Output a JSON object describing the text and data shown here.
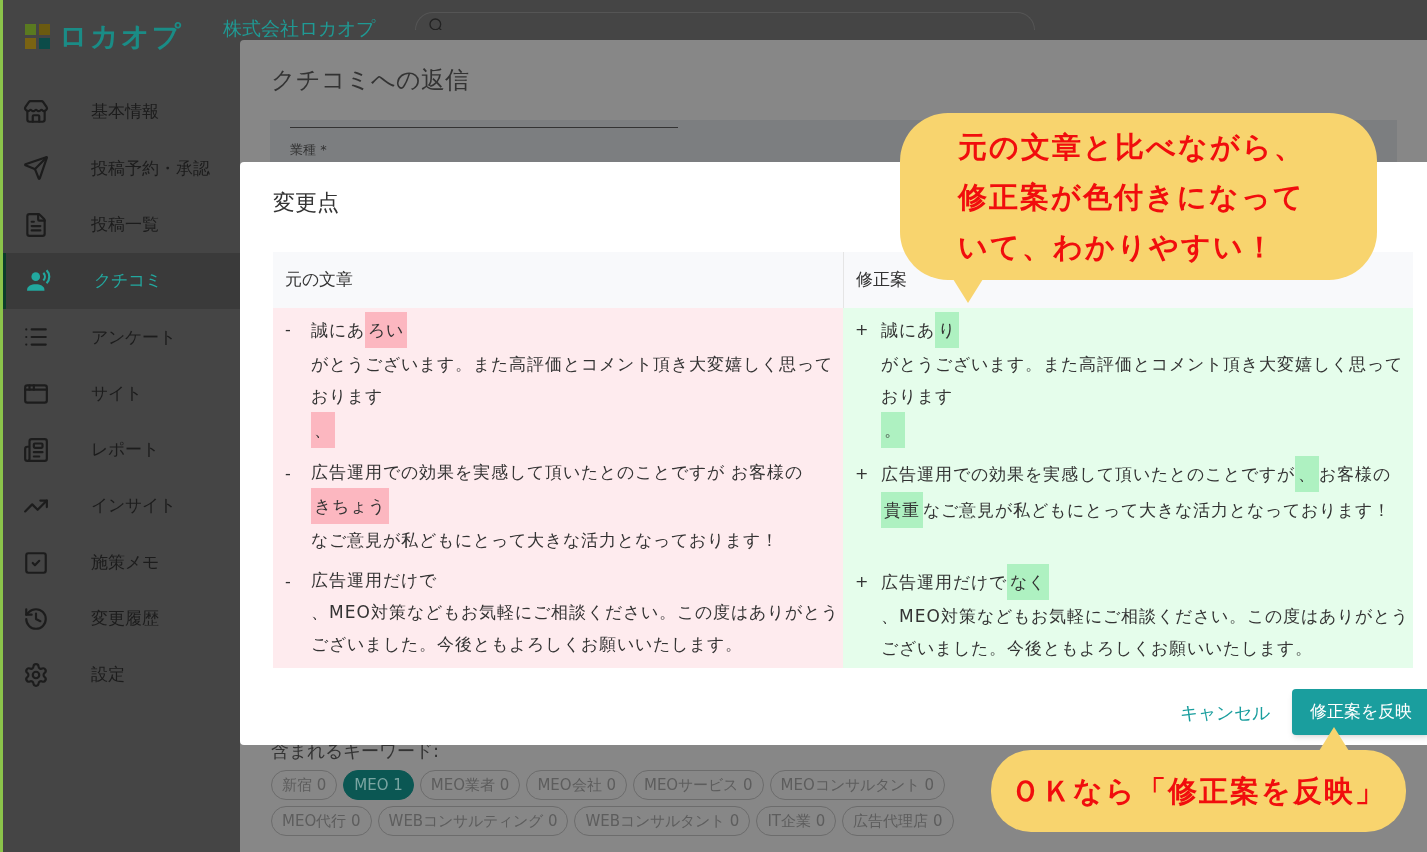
{
  "header": {
    "logo": "ロカオプ",
    "company": "株式会社ロカオプ"
  },
  "sidebar": {
    "items": [
      {
        "label": "基本情報",
        "selected": false
      },
      {
        "label": "投稿予約・承認",
        "selected": false
      },
      {
        "label": "投稿一覧",
        "selected": false
      },
      {
        "label": "クチコミ",
        "selected": true
      },
      {
        "label": "アンケート",
        "selected": false
      },
      {
        "label": "サイト",
        "selected": false
      },
      {
        "label": "レポート",
        "selected": false
      },
      {
        "label": "インサイト",
        "selected": false
      },
      {
        "label": "施策メモ",
        "selected": false
      },
      {
        "label": "変更履歴",
        "selected": false
      },
      {
        "label": "設定",
        "selected": false
      }
    ]
  },
  "reply_dialog": {
    "title": "クチコミへの返信",
    "field_label": "業種 *",
    "keywords_label": "含まれるキーワード:",
    "keyword_rows": [
      [
        {
          "label": "新宿 0",
          "selected": false
        },
        {
          "label": "MEO 1",
          "selected": true
        },
        {
          "label": "MEO業者 0",
          "selected": false
        },
        {
          "label": "MEO会社 0",
          "selected": false
        },
        {
          "label": "MEOサービス 0",
          "selected": false
        },
        {
          "label": "MEOコンサルタント 0",
          "selected": false
        }
      ],
      [
        {
          "label": "MEO代行 0",
          "selected": false
        },
        {
          "label": "WEBコンサルティング 0",
          "selected": false
        },
        {
          "label": "WEBコンサルタント 0",
          "selected": false
        },
        {
          "label": "IT企業 0",
          "selected": false
        },
        {
          "label": "広告代理店 0",
          "selected": false
        }
      ]
    ]
  },
  "diff_dialog": {
    "title": "変更点",
    "columns": [
      {
        "label": "元の文章",
        "kind": "removed"
      },
      {
        "label": "修正案",
        "kind": "added"
      }
    ],
    "rows": [
      {
        "original": {
          "sign": "-",
          "lines": [
            [
              {
                "text": "誠にあ",
                "changed": false
              },
              {
                "text": "ろい",
                "changed": true
              }
            ],
            [
              {
                "text": "がとうございます。また高評価とコメント頂き大変嬉しく思っております",
                "changed": false
              }
            ],
            [
              {
                "text": "、",
                "changed": true
              }
            ]
          ]
        },
        "revised": {
          "sign": "+",
          "lines": [
            [
              {
                "text": "誠にあ",
                "changed": false
              },
              {
                "text": "り",
                "changed": true
              }
            ],
            [
              {
                "text": "がとうございます。また高評価とコメント頂き大変嬉しく思っております",
                "changed": false
              }
            ],
            [
              {
                "text": "。",
                "changed": true
              }
            ]
          ]
        }
      },
      {
        "original": {
          "sign": "-",
          "lines": [
            [
              {
                "text": "広告運用での効果を実感して頂いたとのことですが お客様の",
                "changed": false
              }
            ],
            [
              {
                "text": "きちょう",
                "changed": true
              }
            ],
            [
              {
                "text": "なご意見が私どもにとって大きな活力となっております！",
                "changed": false
              }
            ]
          ]
        },
        "revised": {
          "sign": "+",
          "lines": [
            [
              {
                "text": "広告運用での効果を実感して頂いたとのことですが",
                "changed": false
              },
              {
                "text": "、",
                "changed": true
              },
              {
                "text": "お客様の",
                "changed": false
              }
            ],
            [
              {
                "text": "貴重",
                "changed": true
              },
              {
                "text": "なご意見が私どもにとって大きな活力となっております！",
                "changed": false
              }
            ]
          ]
        }
      },
      {
        "original": {
          "sign": "-",
          "lines": [
            [
              {
                "text": "広告運用だけで",
                "changed": false
              }
            ],
            [
              {
                "text": "、MEO対策などもお気軽にご相談ください。この度はありがとうございました。今後ともよろしくお願いいたします。",
                "changed": false
              }
            ]
          ]
        },
        "revised": {
          "sign": "+",
          "lines": [
            [
              {
                "text": "広告運用だけで",
                "changed": false
              },
              {
                "text": "なく",
                "changed": true
              }
            ],
            [
              {
                "text": "、MEO対策などもお気軽にご相談ください。この度はありがとうございました。今後ともよろしくお願いいたします。",
                "changed": false
              }
            ]
          ]
        }
      }
    ],
    "cancel": "キャンセル",
    "apply": "修正案を反映"
  },
  "callouts": [
    {
      "kind": "top",
      "lines": [
        "元の文章と比べながら、",
        "修正案が色付きになって",
        "いて、わかりやすい！"
      ]
    },
    {
      "kind": "bottom",
      "lines": [
        "ＯＫなら「修正案を反映」"
      ]
    }
  ]
}
